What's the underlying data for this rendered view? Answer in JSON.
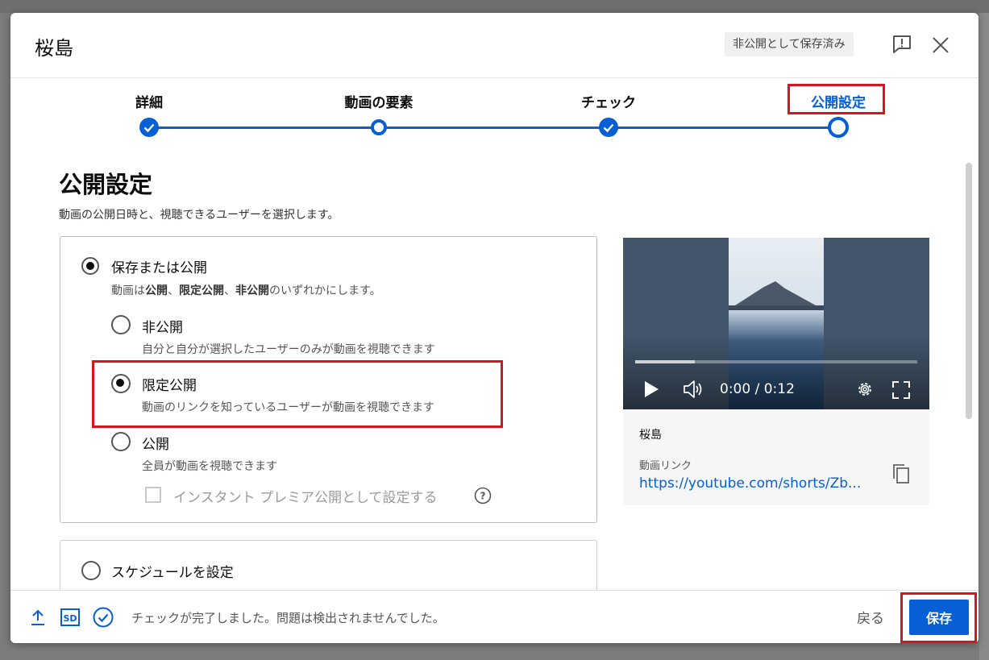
{
  "dialog": {
    "title": "桜島",
    "saved_badge": "非公開として保存済み"
  },
  "stepper": {
    "steps": [
      {
        "label": "詳細",
        "state": "done"
      },
      {
        "label": "動画の要素",
        "state": "open"
      },
      {
        "label": "チェック",
        "state": "done"
      },
      {
        "label": "公開設定",
        "state": "current"
      }
    ]
  },
  "visibility": {
    "title": "公開設定",
    "description": "動画の公開日時と、視聴できるユーザーを選択します。",
    "save_or_publish": {
      "label": "保存または公開",
      "desc_parts": [
        "動画は",
        "公開",
        "、",
        "限定公開",
        "、",
        "非公開",
        "のいずれかにします。"
      ]
    },
    "options": [
      {
        "label": "非公開",
        "desc": "自分と自分が選択したユーザーのみが動画を視聴できます",
        "selected": false
      },
      {
        "label": "限定公開",
        "desc": "動画のリンクを知っているユーザーが動画を視聴できます",
        "selected": true
      },
      {
        "label": "公開",
        "desc": "全員が動画を視聴できます",
        "selected": false
      }
    ],
    "premiere_label": "インスタント プレミア公開として設定する",
    "schedule": {
      "label": "スケジュールを設定"
    }
  },
  "preview": {
    "time": "0:00 / 0:12",
    "progress": 0.21,
    "title": "桜島",
    "link_label": "動画リンク",
    "link_url": "https://youtube.com/shorts/Zb..."
  },
  "footer": {
    "status": "チェックが完了しました。問題は検出されませんでした。",
    "sd_label": "SD",
    "back_label": "戻る",
    "save_label": "保存"
  },
  "colors": {
    "accent": "#065fd4",
    "highlight": "#d4171e"
  }
}
